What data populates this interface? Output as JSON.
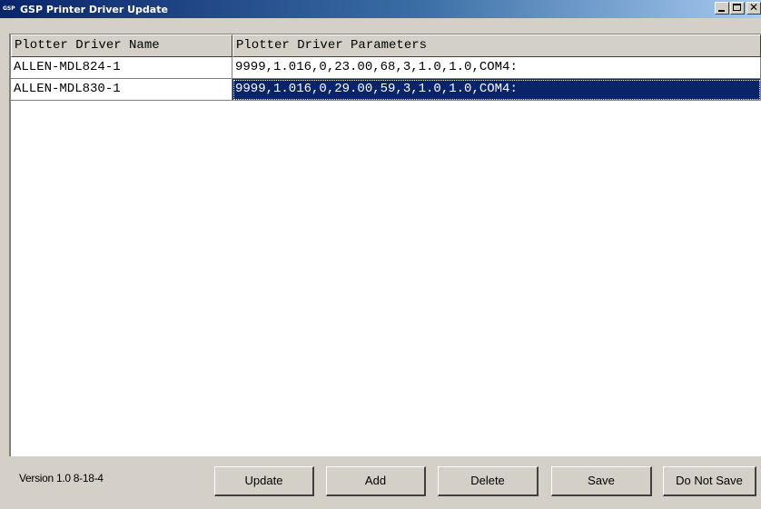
{
  "window": {
    "title": "GSP Printer Driver Update",
    "icon_text": "GSP",
    "controls": {
      "minimize": "minimize-icon",
      "maximize": "maximize-icon",
      "close": "close-icon"
    }
  },
  "table": {
    "columns": [
      "Plotter Driver Name",
      "Plotter Driver Parameters"
    ],
    "rows": [
      {
        "name": "ALLEN-MDL824-1",
        "params": "9999,1.016,0,23.00,68,3,1.0,1.0,COM4:",
        "selected": false
      },
      {
        "name": "ALLEN-MDL830-1",
        "params": "9999,1.016,0,29.00,59,3,1.0,1.0,COM4:",
        "selected": true
      }
    ]
  },
  "footer": {
    "version": "Version 1.0 8-18-4",
    "buttons": {
      "update": "Update",
      "add": "Add",
      "delete": "Delete",
      "save": "Save",
      "do_not_save": "Do Not Save"
    }
  },
  "colors": {
    "titlebar_start": "#0a246a",
    "titlebar_end": "#a6caf0",
    "selection": "#0a246a",
    "face": "#d4d0c8"
  }
}
